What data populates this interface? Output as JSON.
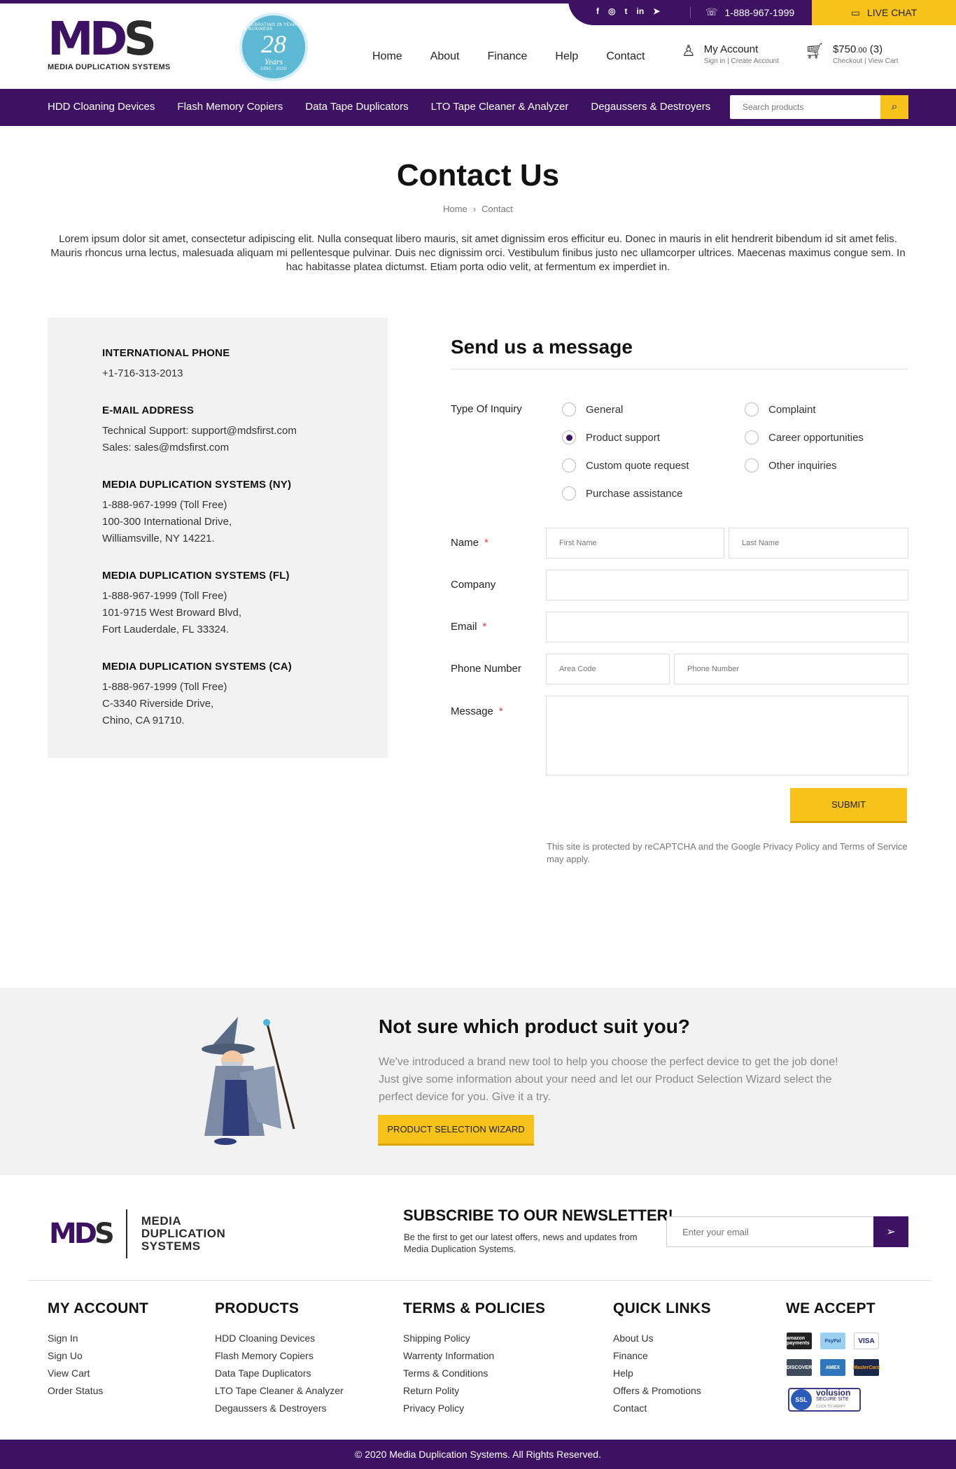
{
  "topbar": {
    "social": [
      "f",
      "◎",
      "t",
      "in",
      "➤"
    ],
    "phone": "1-888-967-1999",
    "live_chat": "LIVE CHAT"
  },
  "logo": {
    "mark_a": "MD",
    "mark_b": "S",
    "subtitle": "MEDIA DUPLICATION SYSTEMS"
  },
  "badge": {
    "caption": "CELEBRATING 28 YEARS IN BUSINESS",
    "number": "28",
    "years": "Years",
    "range": "1992 - 2020"
  },
  "nav": [
    "Home",
    "About",
    "Finance",
    "Help",
    "Contact"
  ],
  "account": {
    "title": "My Account",
    "sign_in": "Sign in",
    "create": "Create Account"
  },
  "cart": {
    "amount": "$750",
    "cents": ".00",
    "count": "(3)",
    "checkout": "Checkout",
    "view": "View Cart"
  },
  "categories": [
    "HDD Cloaning Devices",
    "Flash Memory Copiers",
    "Data Tape Duplicators",
    "LTO Tape Cleaner & Analyzer",
    "Degaussers & Destroyers"
  ],
  "search": {
    "placeholder": "Search products"
  },
  "page": {
    "title": "Contact Us",
    "breadcrumb_home": "Home",
    "breadcrumb_current": "Contact",
    "intro": "Lorem ipsum dolor sit amet, consectetur adipiscing elit. Nulla consequat libero mauris, sit amet dignissim eros efficitur eu. Donec in mauris in elit hendrerit bibendum id sit amet felis. Mauris rhoncus urna lectus, malesuada aliquam mi pellentesque pulvinar. Duis nec dignissim orci. Vestibulum finibus justo nec ullamcorper ultrices. Maecenas maximus congue sem. In hac habitasse platea dictumst. Etiam porta odio velit, at fermentum ex imperdiet in."
  },
  "info": [
    {
      "heading": "INTERNATIONAL PHONE",
      "lines": [
        "+1-716-313-2013"
      ]
    },
    {
      "heading": "E-MAIL ADDRESS",
      "lines": [
        "Technical Support: support@mdsfirst.com",
        "Sales: sales@mdsfirst.com"
      ]
    },
    {
      "heading": "MEDIA DUPLICATION SYSTEMS (NY)",
      "lines": [
        "1-888-967-1999 (Toll Free)",
        "100-300 International Drive,",
        "Williamsville, NY 14221."
      ]
    },
    {
      "heading": "MEDIA DUPLICATION SYSTEMS (FL)",
      "lines": [
        "1-888-967-1999 (Toll Free)",
        "101-9715 West Broward Blvd,",
        "Fort Lauderdale, FL 33324."
      ]
    },
    {
      "heading": "MEDIA DUPLICATION SYSTEMS (CA)",
      "lines": [
        "1-888-967-1999 (Toll Free)",
        "C-3340 Riverside Drive,",
        "Chino, CA 91710."
      ]
    }
  ],
  "form": {
    "title": "Send us a message",
    "inquiry_label": "Type Of Inquiry",
    "inquiry_options": [
      "General",
      "Complaint",
      "Product support",
      "Career opportunities",
      "Custom quote request",
      "Other inquiries",
      "Purchase assistance"
    ],
    "selected_option": "Product support",
    "name_label": "Name",
    "first_name_placeholder": "First Name",
    "last_name_placeholder": "Last Name",
    "company_label": "Company",
    "email_label": "Email",
    "phone_label": "Phone Number",
    "area_code_placeholder": "Area Code",
    "phone_placeholder": "Phone Number",
    "message_label": "Message",
    "required_mark": "*",
    "submit": "SUBMIT",
    "recaptcha": "This site is protected by reCAPTCHA and the Google Privacy Policy and Terms of Service may apply."
  },
  "wizard": {
    "title": "Not sure which product suit you?",
    "description": "We've introduced a brand new tool to help you choose the perfect device to get the job done! Just give some information about your need and let our Product Selection Wizard select the perfect device for you. Give it a try.",
    "button": "PRODUCT SELECTION WIZARD"
  },
  "footer": {
    "logo_text_1": "MEDIA",
    "logo_text_2": "DUPLICATION",
    "logo_text_3": "SYSTEMS",
    "newsletter_title": "SUBSCRIBE TO OUR NEWSLETTER!",
    "newsletter_desc": "Be the first to get our latest offers, news and updates from Media Duplication Systems.",
    "email_placeholder": "Enter your email",
    "columns": [
      {
        "heading": "MY ACCOUNT",
        "links": [
          "Sign In",
          "Sign Uo",
          "View Cart",
          "Order Status"
        ]
      },
      {
        "heading": "PRODUCTS",
        "links": [
          "HDD Cloaning Devices",
          "Flash Memory Copiers",
          "Data Tape Duplicators",
          "LTO Tape Cleaner & Analyzer",
          "Degaussers & Destroyers"
        ]
      },
      {
        "heading": "TERMS & POLICIES",
        "links": [
          "Shipping Policy",
          "Warrenty Information",
          "Terms & Conditions",
          "Return Polity",
          "Privacy Policy"
        ]
      },
      {
        "heading": "QUICK LINKS",
        "links": [
          "About Us",
          "Finance",
          "Help",
          "Offers & Promotions",
          "Contact"
        ]
      }
    ],
    "accept_heading": "WE ACCEPT",
    "cards": [
      "amazon payments",
      "PayPal",
      "VISA",
      "DISCOVER",
      "AMEX",
      "MasterCard"
    ],
    "ssl_badge": "SSL",
    "ssl_brand": "volusion",
    "ssl_secure": "SECURE SITE",
    "ssl_verify": "CLICK TO VERIFY",
    "copyright": "© 2020 Media Duplication Systems. All Rights Reserved."
  },
  "colors": {
    "brand_purple": "#3d1263",
    "accent_yellow": "#f7c21a",
    "required_red": "#e03c3c"
  }
}
